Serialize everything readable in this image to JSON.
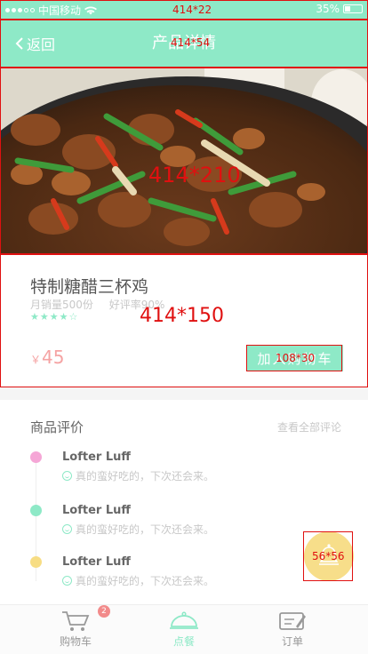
{
  "status_bar": {
    "carrier": "中国移动",
    "battery": "35%",
    "battery_level": 0.35
  },
  "nav": {
    "back_label": "返回",
    "title": "产品详情"
  },
  "product": {
    "name": "特制糖醋三杯鸡",
    "monthly_sales": "月销量500份",
    "rating_text": "好评率90%",
    "stars": "★★★★☆",
    "currency": "￥",
    "price": "45",
    "add_cart_label": "加入购物车"
  },
  "reviews": {
    "title": "商品评价",
    "view_all": "查看全部评论",
    "items": [
      {
        "name": "Lofter Luff",
        "text": "真的蛮好吃的，下次还会来。",
        "dot_color": "#f5a6d6"
      },
      {
        "name": "Lofter Luff",
        "text": "真的蛮好吃的，下次还会来。",
        "dot_color": "#8ee9c7"
      },
      {
        "name": "Lofter Luff",
        "text": "真的蛮好吃的，下次还会来。",
        "dot_color": "#f7dd84"
      }
    ]
  },
  "tabs": [
    {
      "label": "购物车",
      "badge": "2"
    },
    {
      "label": "点餐"
    },
    {
      "label": "订单"
    }
  ],
  "annotations": {
    "status": "414*22",
    "nav": "414*54",
    "hero": "414*210",
    "card": "414*150",
    "button": "108*30",
    "fab": "56*56"
  },
  "colors": {
    "accent": "#8ee9c7",
    "price": "#f5a3a3",
    "fab": "#f7dd84",
    "badge": "#f28b8b"
  }
}
